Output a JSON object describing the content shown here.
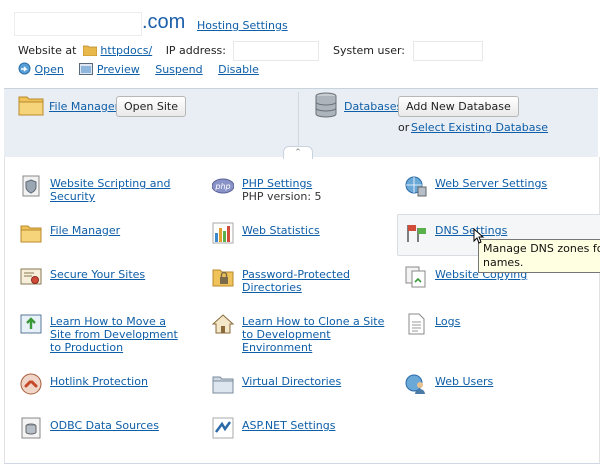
{
  "header": {
    "domain_suffix": ".com",
    "hosting_settings": "Hosting Settings",
    "website_at_label": "Website at",
    "httpdocs": "httpdocs/",
    "ip_label": "IP address:",
    "system_user_label": "System user:",
    "actions": [
      "Open",
      "Preview",
      "Suspend",
      "Disable"
    ]
  },
  "panel": {
    "file_manager": "File Manager",
    "open_site": "Open Site",
    "databases": "Databases",
    "add_database": "Add New Database",
    "or_label": "or",
    "select_existing": "Select Existing Database"
  },
  "items": {
    "website_scripting": "Website Scripting and Security",
    "php_settings": "PHP Settings",
    "php_version": "PHP version: 5",
    "web_server_settings": "Web Server Settings",
    "file_manager": "File Manager",
    "web_statistics": "Web Statistics",
    "dns_settings": "DNS Settings",
    "secure_sites": "Secure Your Sites",
    "password_dirs": "Password-Protected Directories",
    "website_copying": "Website Copying",
    "move_site": "Learn How to Move a Site from Development to Production",
    "clone_site": "Learn How to Clone a Site to Development Environment",
    "logs": "Logs",
    "hotlink": "Hotlink Protection",
    "virtual_dirs": "Virtual Directories",
    "web_users": "Web Users",
    "odbc": "ODBC Data Sources",
    "aspnet": "ASP.NET Settings"
  },
  "tooltip": {
    "line1": "Manage DNS zones for y",
    "line2": "names."
  },
  "colors": {
    "link": "#0e5ea8",
    "panel_bg": "#e9eef4",
    "tooltip_bg": "#ffffe1"
  }
}
